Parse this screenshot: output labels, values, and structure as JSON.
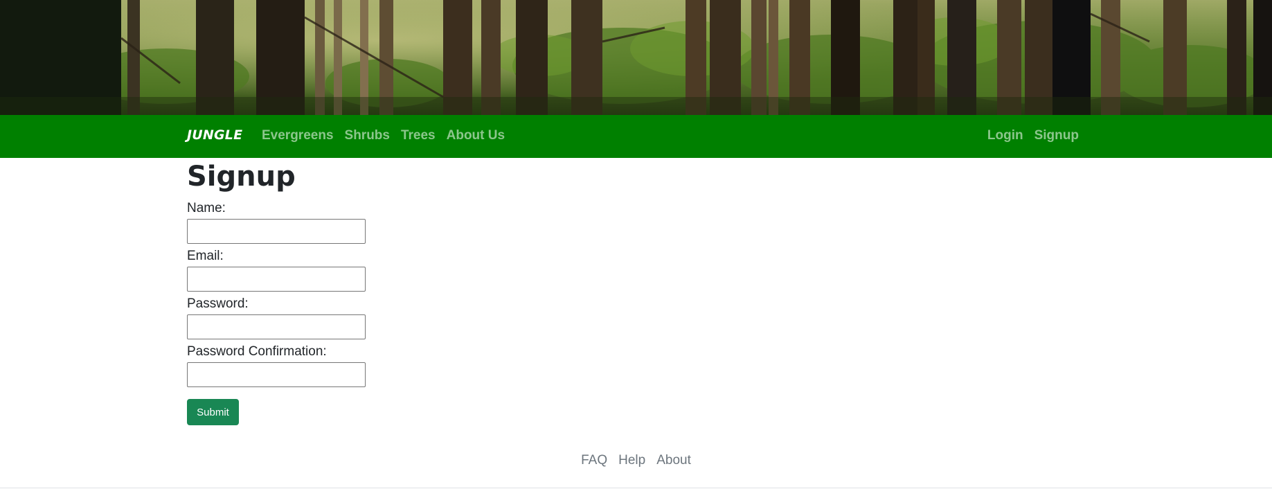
{
  "colors": {
    "navbar_bg": "#008000",
    "nav_link": "rgba(255,255,255,0.55)",
    "submit_bg": "#198754",
    "footer_link": "#6c757d"
  },
  "banner": {
    "image": "forest-trees-photo"
  },
  "navbar": {
    "brand": "JUNGLE",
    "links": [
      {
        "label": "Evergreens"
      },
      {
        "label": "Shrubs"
      },
      {
        "label": "Trees"
      },
      {
        "label": "About Us"
      }
    ],
    "right_links": [
      {
        "label": "Login"
      },
      {
        "label": "Signup"
      }
    ]
  },
  "signup": {
    "title": "Signup",
    "fields": [
      {
        "label": "Name:",
        "value": ""
      },
      {
        "label": "Email:",
        "value": ""
      },
      {
        "label": "Password:",
        "value": ""
      },
      {
        "label": "Password Confirmation:",
        "value": ""
      }
    ],
    "submit_label": "Submit"
  },
  "footer": {
    "links": [
      {
        "label": "FAQ"
      },
      {
        "label": "Help"
      },
      {
        "label": "About"
      }
    ]
  }
}
